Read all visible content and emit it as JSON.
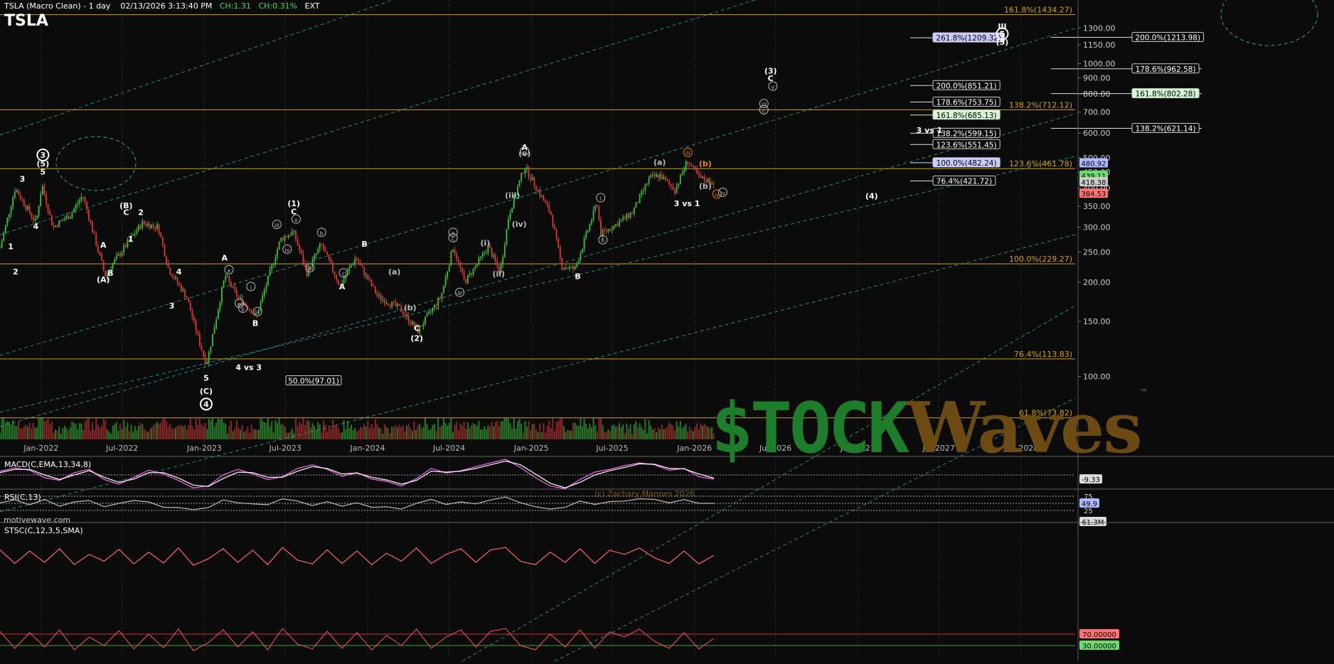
{
  "header": {
    "title": "TSLA (Macro Clean) - 1 day",
    "datetime": "02/13/2026 3:13:40 PM",
    "change_abs": "CH:1.31",
    "change_pct": "CH:0.31%",
    "session": "EXT",
    "symbol": "TSLA"
  },
  "source_label": "motivewave.com",
  "copyright": "(c) Zachary Mannes 2026",
  "watermark": {
    "left": "$TOCK",
    "right": "Waves",
    "tm": "™"
  },
  "colors": {
    "background": "#0b0b0b",
    "up": "#3fbf3f",
    "down": "#d93a3a",
    "fib_line": "#d4a017",
    "channel": "#2aa8a8",
    "wave_label": "#ffffff",
    "orange_label": "#e0891a"
  },
  "chart_data": [
    {
      "type": "candlestick",
      "name": "price",
      "y_scale": "log",
      "ylim": [
        63,
        1500
      ],
      "xlim": [
        "2021-10-01",
        "2028-05-01"
      ],
      "x_ticks": [
        "Jan-2022",
        "Jul-2022",
        "Jan-2023",
        "Jul-2023",
        "Jan-2024",
        "Jul-2024",
        "Jan-2025",
        "Jul-2025",
        "Jan-2026",
        "Jul-2026",
        "Jan-2027",
        "Jul-2027",
        "Jan-2028"
      ],
      "y_ticks": [
        100,
        150,
        200,
        250,
        300,
        350,
        400,
        450,
        500,
        600,
        700,
        800,
        900,
        1000,
        1150,
        1300
      ],
      "y_tick_labels": [
        "100.00",
        "150.00",
        "200.00",
        "250.00",
        "300.00",
        "350.00",
        "400.00",
        "450.00",
        "500.00",
        "600.00",
        "700.00",
        "800.00",
        "900.00",
        "1000.00",
        "1150.00",
        "1300.00"
      ],
      "series": [
        {
          "x": [
            "2021-10-01",
            "2021-11-04",
            "2021-12-20",
            "2022-01-03",
            "2022-01-27",
            "2022-03-08",
            "2022-04-04",
            "2022-05-24",
            "2022-06-15",
            "2022-08-15",
            "2022-09-20",
            "2022-10-13",
            "2022-11-22",
            "2022-12-27",
            "2023-01-06",
            "2023-02-16",
            "2023-03-16",
            "2023-04-12",
            "2023-04-27",
            "2023-06-20",
            "2023-07-19",
            "2023-08-18",
            "2023-09-19",
            "2023-10-31",
            "2023-12-05",
            "2024-01-24",
            "2024-03-13",
            "2024-04-22",
            "2024-06-13",
            "2024-07-10",
            "2024-08-05",
            "2024-09-27",
            "2024-10-23",
            "2024-11-12",
            "2024-12-17",
            "2025-01-13",
            "2025-02-14",
            "2025-03-10",
            "2025-04-08",
            "2025-05-28",
            "2025-06-05",
            "2025-07-15",
            "2025-08-15",
            "2025-09-22",
            "2025-10-15",
            "2025-11-18",
            "2025-12-16",
            "2026-01-12",
            "2026-02-13"
          ],
          "close": [
            258,
            400,
            310,
            410,
            300,
            330,
            380,
            210,
            235,
            310,
            300,
            220,
            180,
            120,
            110,
            210,
            180,
            165,
            155,
            275,
            290,
            215,
            265,
            195,
            240,
            180,
            165,
            140,
            180,
            260,
            200,
            260,
            215,
            330,
            470,
            400,
            330,
            225,
            220,
            360,
            285,
            310,
            335,
            430,
            440,
            395,
            490,
            430,
            418
          ]
        }
      ],
      "volume_axis_label": "61.3M",
      "price_tags": [
        {
          "value": "480.92",
          "color": "#b0b8ff"
        },
        {
          "value": "439.11",
          "color": "#6fdc6f"
        },
        {
          "value": "418.38",
          "color": "#cccccc"
        },
        {
          "value": "384.53",
          "color": "#ff7373"
        }
      ],
      "horizontal_fib_lines": [
        {
          "label": "161.8%(1434.27)",
          "value": 1434.27
        },
        {
          "label": "138.2%(712.12)",
          "value": 712.12
        },
        {
          "label": "123.6%(461.78)",
          "value": 461.78
        },
        {
          "label": "100.0%(229.27)",
          "value": 229.27
        },
        {
          "label": "76.4%(113.83)",
          "value": 113.83
        },
        {
          "label": "61.8%(73.82)",
          "value": 73.82
        }
      ],
      "fib_targets_left": [
        {
          "label": "261.8%(1209.32)",
          "value": 1209.32,
          "style": "blue"
        },
        {
          "label": "200.0%(851.21)",
          "value": 851.21,
          "style": "white"
        },
        {
          "label": "178.6%(753.75)",
          "value": 753.75,
          "style": "white"
        },
        {
          "label": "161.8%(685.13)",
          "value": 685.13,
          "style": "green"
        },
        {
          "label": "138.2%(599.15)",
          "value": 599.15,
          "style": "white"
        },
        {
          "label": "123.6%(551.45)",
          "value": 551.45,
          "style": "white"
        },
        {
          "label": "100.0%(482.24)",
          "value": 482.24,
          "style": "blue"
        },
        {
          "label": "76.4%(421.72)",
          "value": 421.72,
          "style": "white"
        }
      ],
      "fib_targets_right": [
        {
          "label": "200.0%(1213.98)",
          "value": 1213.98,
          "style": "white"
        },
        {
          "label": "178.6%(962.58)",
          "value": 962.58,
          "style": "white"
        },
        {
          "label": "161.8%(802.28)",
          "value": 802.28,
          "style": "green"
        },
        {
          "label": "138.2%(621.14)",
          "value": 621.14,
          "style": "white"
        }
      ],
      "fib_low_tag": {
        "label": "50.0%(97.01)",
        "value": 97.01
      },
      "wave_labels": [
        {
          "t": "1",
          "x": "2021-10-25",
          "y": 255
        },
        {
          "t": "2",
          "x": "2021-11-05",
          "y": 212
        },
        {
          "t": "3",
          "x": "2021-11-20",
          "y": 420
        },
        {
          "t": "4",
          "x": "2021-12-20",
          "y": 296
        },
        {
          "t": "5",
          "x": "2022-01-05",
          "y": 442
        },
        {
          "t": "(5)",
          "x": "2022-01-05",
          "y": 470
        },
        {
          "t": "3",
          "x": "2022-01-05",
          "y": 500,
          "circled": true,
          "bold": true
        },
        {
          "t": "A",
          "x": "2022-05-20",
          "y": 258
        },
        {
          "t": "B",
          "x": "2022-06-05",
          "y": 210
        },
        {
          "t": "(A)",
          "x": "2022-05-20",
          "y": 200
        },
        {
          "t": "(B)",
          "x": "2022-07-10",
          "y": 345
        },
        {
          "t": "C",
          "x": "2022-07-10",
          "y": 328
        },
        {
          "t": "2",
          "x": "2022-08-12",
          "y": 328
        },
        {
          "t": "1",
          "x": "2022-07-20",
          "y": 270
        },
        {
          "t": "4",
          "x": "2022-11-05",
          "y": 212
        },
        {
          "t": "3",
          "x": "2022-10-20",
          "y": 165
        },
        {
          "t": "5",
          "x": "2023-01-05",
          "y": 97
        },
        {
          "t": "(C)",
          "x": "2023-01-05",
          "y": 88
        },
        {
          "t": "4",
          "x": "2023-01-05",
          "y": 80,
          "circled": true,
          "bold": true
        },
        {
          "t": "4 vs 3",
          "x": "2023-04-10",
          "y": 105
        },
        {
          "t": "A",
          "x": "2023-02-15",
          "y": 235
        },
        {
          "t": "B",
          "x": "2023-04-25",
          "y": 145
        },
        {
          "t": "(1)",
          "x": "2023-07-20",
          "y": 350
        },
        {
          "t": "C",
          "x": "2023-07-20",
          "y": 330
        },
        {
          "t": "A",
          "x": "2023-11-05",
          "y": 190
        },
        {
          "t": "B",
          "x": "2023-12-25",
          "y": 260
        },
        {
          "t": "C",
          "x": "2024-04-20",
          "y": 140
        },
        {
          "t": "(2)",
          "x": "2024-04-20",
          "y": 130
        },
        {
          "t": "A",
          "x": "2024-12-17",
          "y": 530
        },
        {
          "t": "B",
          "x": "2025-04-15",
          "y": 205
        },
        {
          "t": "3 vs 1",
          "x": "2025-12-15",
          "y": 350
        },
        {
          "t": "(3)",
          "x": "2026-06-20",
          "y": 930
        },
        {
          "t": "C",
          "x": "2026-06-20",
          "y": 880
        },
        {
          "t": "3 vs 1",
          "x": "2027-06-10",
          "y": 600
        },
        {
          "t": "(4)",
          "x": "2027-02-01",
          "y": 370
        },
        {
          "t": "III",
          "x": "2027-11-20",
          "y": 1290
        },
        {
          "t": "5",
          "x": "2027-11-20",
          "y": 1220,
          "circled": true,
          "bold": true
        },
        {
          "t": "(5)",
          "x": "2027-11-20",
          "y": 1150
        }
      ],
      "subwave_labels": [
        {
          "t": "x",
          "x": "2023-02-25",
          "y": 215,
          "circled": true
        },
        {
          "t": "w",
          "x": "2023-03-20",
          "y": 168,
          "circled": true
        },
        {
          "t": "i",
          "x": "2023-04-15",
          "y": 190,
          "circled": true
        },
        {
          "t": "ii",
          "x": "2023-04-30",
          "y": 158,
          "circled": true
        },
        {
          "t": "y",
          "x": "2023-03-28",
          "y": 162,
          "circled": true
        },
        {
          "t": "iii",
          "x": "2023-06-12",
          "y": 300,
          "circled": true
        },
        {
          "t": "iv",
          "x": "2023-07-05",
          "y": 250,
          "circled": true
        },
        {
          "t": "v",
          "x": "2023-07-25",
          "y": 312,
          "circled": true
        },
        {
          "t": "b",
          "x": "2023-09-20",
          "y": 283,
          "circled": true
        },
        {
          "t": "a",
          "x": "2023-08-25",
          "y": 218,
          "circled": true
        },
        {
          "t": "c",
          "x": "2023-11-08",
          "y": 210,
          "circled": true
        },
        {
          "t": "(a)",
          "x": "2024-03-01",
          "y": 212
        },
        {
          "t": "(b)",
          "x": "2024-04-05",
          "y": 163
        },
        {
          "t": "a",
          "x": "2024-07-10",
          "y": 283,
          "circled": true
        },
        {
          "t": "c",
          "x": "2024-07-10",
          "y": 272,
          "circled": true
        },
        {
          "t": "b",
          "x": "2024-07-25",
          "y": 182,
          "circled": true
        },
        {
          "t": "(i)",
          "x": "2024-09-20",
          "y": 262
        },
        {
          "t": "(ii)",
          "x": "2024-10-20",
          "y": 209
        },
        {
          "t": "(iii)",
          "x": "2024-11-20",
          "y": 372
        },
        {
          "t": "(iv)",
          "x": "2024-12-05",
          "y": 301
        },
        {
          "t": "(v)",
          "x": "2024-12-17",
          "y": 507
        },
        {
          "t": "c",
          "x": "2024-12-17",
          "y": 515,
          "circled": true
        },
        {
          "t": "i",
          "x": "2025-06-05",
          "y": 365,
          "circled": true
        },
        {
          "t": "ii",
          "x": "2025-06-10",
          "y": 268,
          "circled": true
        },
        {
          "t": "(a)",
          "x": "2025-10-15",
          "y": 475
        },
        {
          "t": "iii",
          "x": "2025-12-17",
          "y": 510,
          "circled": true,
          "orange": true
        },
        {
          "t": "(b)",
          "x": "2026-01-25",
          "y": 470,
          "orange": true
        },
        {
          "t": "(b)",
          "x": "2026-01-25",
          "y": 398
        },
        {
          "t": "iv",
          "x": "2026-02-20",
          "y": 375,
          "circled": true,
          "orange": true
        },
        {
          "t": "iv",
          "x": "2026-03-05",
          "y": 380,
          "circled": true
        },
        {
          "t": "iii",
          "x": "2026-06-05",
          "y": 730,
          "circled": true
        },
        {
          "t": "c",
          "x": "2026-06-05",
          "y": 697,
          "circled": true
        },
        {
          "t": "v",
          "x": "2026-06-25",
          "y": 830,
          "circled": true
        }
      ]
    },
    {
      "type": "line",
      "name": "MACD",
      "title": "MACD(C,EMA,13,34,8)",
      "value_tag": "-9.33",
      "ylim": [
        -40,
        40
      ],
      "series": [
        {
          "name": "MACD",
          "values": [
            8,
            15,
            10,
            -6,
            -12,
            5,
            12,
            -10,
            -20,
            -5,
            10,
            2,
            -12,
            -28,
            -24,
            0,
            12,
            2,
            -10,
            -4,
            14,
            22,
            12,
            -3,
            5,
            -9,
            -14,
            -24,
            -8,
            14,
            4,
            9,
            18,
            26,
            34,
            16,
            -6,
            -24,
            -30,
            -10,
            6,
            12,
            20,
            26,
            22,
            10,
            14,
            -4,
            -9
          ]
        },
        {
          "name": "Signal",
          "values": [
            5,
            12,
            12,
            0,
            -10,
            0,
            9,
            -5,
            -16,
            -9,
            5,
            5,
            -7,
            -22,
            -25,
            -8,
            6,
            5,
            -5,
            -5,
            8,
            18,
            14,
            2,
            4,
            -5,
            -11,
            -20,
            -12,
            8,
            6,
            8,
            14,
            22,
            30,
            22,
            2,
            -18,
            -28,
            -16,
            0,
            9,
            16,
            24,
            23,
            14,
            13,
            2,
            -7
          ]
        }
      ]
    },
    {
      "type": "line",
      "name": "RSI",
      "title": "RSI(C,13)",
      "value_tag": "49.9",
      "ylim": [
        0,
        100
      ],
      "y_ticks": [
        75,
        25
      ],
      "reference_lines": [
        75,
        50,
        25
      ],
      "values": [
        52,
        62,
        45,
        64,
        40,
        55,
        60,
        38,
        50,
        60,
        55,
        36,
        35,
        28,
        35,
        62,
        52,
        48,
        45,
        66,
        58,
        42,
        56,
        40,
        52,
        36,
        38,
        30,
        50,
        64,
        46,
        55,
        48,
        62,
        72,
        52,
        38,
        30,
        36,
        58,
        46,
        56,
        58,
        66,
        64,
        52,
        63,
        50,
        49.9
      ]
    },
    {
      "type": "line",
      "name": "STSC",
      "title": "STSC(C,12,3,5,SMA)",
      "value_tags": [
        "70.00000",
        "30.00000"
      ],
      "ylim": [
        0,
        100
      ],
      "reference_lines": [
        70,
        30
      ],
      "values": [
        80,
        20,
        75,
        25,
        85,
        15,
        60,
        30,
        82,
        18,
        70,
        22,
        88,
        12,
        40,
        85,
        25,
        78,
        15,
        90,
        35,
        18,
        80,
        20,
        75,
        15,
        65,
        30,
        88,
        20,
        60,
        85,
        25,
        80,
        90,
        30,
        15,
        70,
        25,
        85,
        20,
        78,
        60,
        88,
        45,
        20,
        75,
        18,
        55
      ]
    }
  ]
}
